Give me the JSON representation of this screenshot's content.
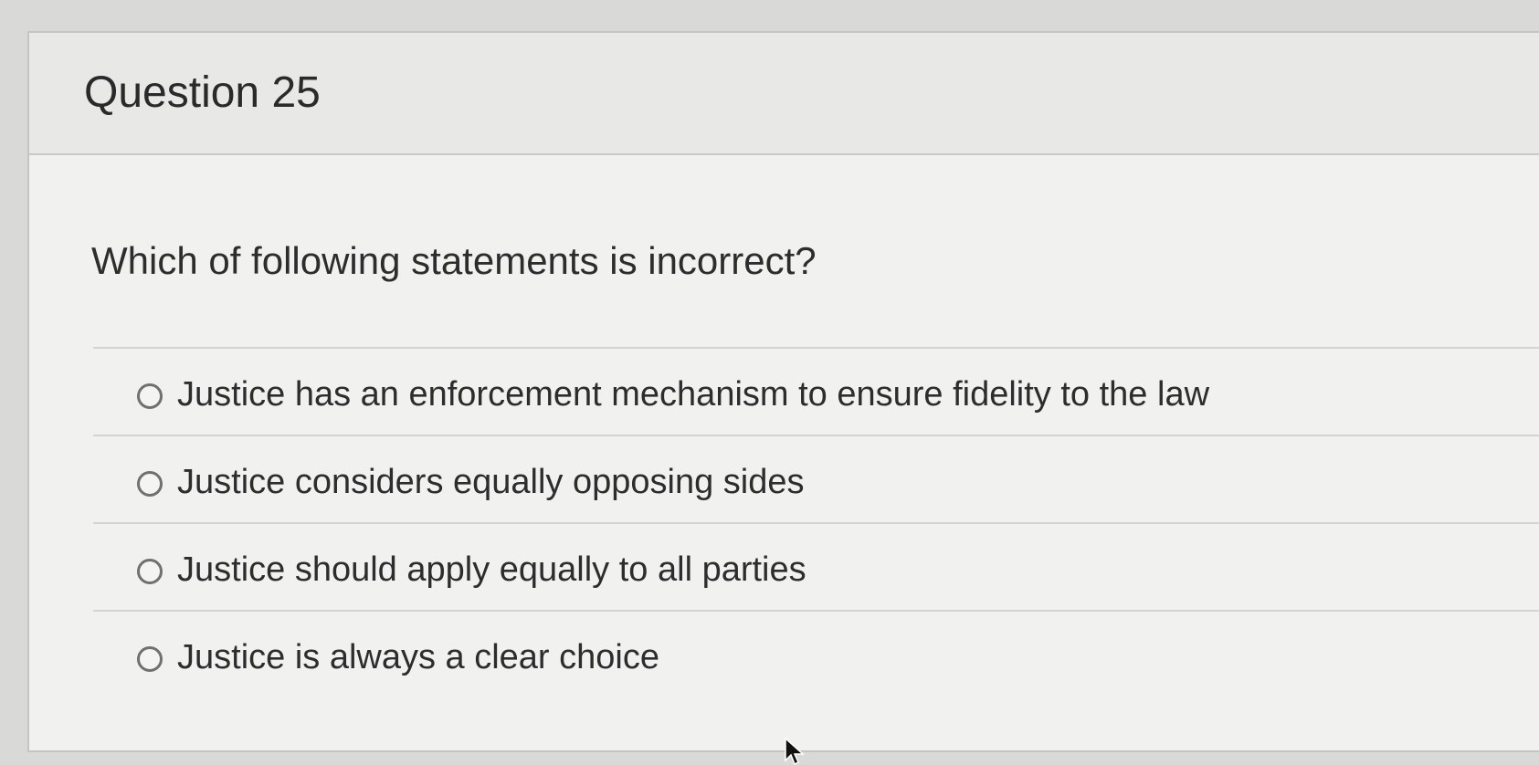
{
  "question": {
    "title": "Question 25",
    "prompt": "Which of following statements is incorrect?",
    "options": [
      {
        "label": "Justice has an enforcement mechanism to ensure fidelity to the law",
        "selected": false
      },
      {
        "label": "Justice considers equally opposing sides",
        "selected": false
      },
      {
        "label": "Justice should apply equally to all parties",
        "selected": false
      },
      {
        "label": "Justice is always a clear choice",
        "selected": false
      }
    ]
  },
  "icons": {
    "radio": "radio-button-icon",
    "cursor": "mouse-pointer-icon"
  },
  "colors": {
    "background": "#d9d9d7",
    "card": "#f1f1ef",
    "header": "#e8e8e6",
    "text": "#2d2d2d",
    "radio_border": "#707070",
    "divider": "#d3d3d1"
  }
}
